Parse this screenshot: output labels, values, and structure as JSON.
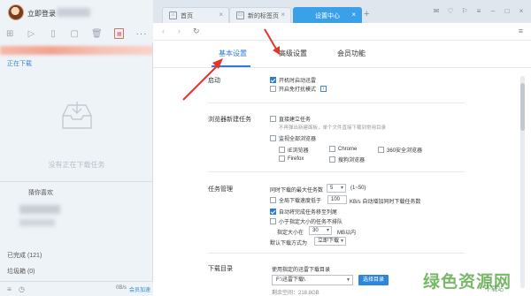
{
  "left": {
    "login_label": "立即登录",
    "downloading_label": "正在下载",
    "empty_text": "没有正在下载任务",
    "recommend_label": "猜你喜欢",
    "completed_label": "已完成 (121)",
    "trash_label": "垃圾箱 (0)",
    "speed_text": "0B/s",
    "member_label": "会员加速"
  },
  "tabs": [
    {
      "label": "首页",
      "icon": "home-icon"
    },
    {
      "label": "新的标签页",
      "icon": "page-icon"
    },
    {
      "label": "设置中心",
      "active": true
    }
  ],
  "settings_tabs": [
    {
      "label": "基本设置",
      "active": true
    },
    {
      "label": "高级设置"
    },
    {
      "label": "会员功能"
    }
  ],
  "startup": {
    "section_label": "启动",
    "auto_start": "开机时启动迅雷",
    "no_disturb": "开启免打扰模式"
  },
  "browser_task": {
    "section_label": "浏览器新建任务",
    "direct_create": "直接建立任务",
    "direct_hint": "不再弹出新建面板，单个文件直接下载到常用目录",
    "monitor_all": "监视全部浏览器",
    "browsers": [
      "IE浏览器",
      "Chrome",
      "360安全浏览器",
      "Firefox",
      "搜狗浏览器"
    ]
  },
  "task_manage": {
    "section_label": "任务管理",
    "max_tasks_label": "同时下载的最大任务数",
    "max_tasks_value": "5",
    "max_tasks_range": "(1~50)",
    "low_speed_label": "全局下载速度低于",
    "low_speed_value": "100",
    "low_speed_suffix": "KB/s 自动增加同时下载任务数",
    "auto_move_done": "自动将完成任务移至列尾",
    "small_task_label": "小于指定大小的任务不排队",
    "size_label": "指定大小在",
    "size_value": "30",
    "size_unit": "MB以内",
    "default_mode_label": "默认下载方式为",
    "default_mode_value": "立即下载"
  },
  "download_dir": {
    "section_label": "下载目录",
    "use_last_label": "使用指定的迅雷下载目录",
    "path_value": "F:\\迅雷下载\\",
    "choose_button": "选择目录",
    "free_space": "剩余空间：218.8GB"
  },
  "watermark": {
    "main": "绿色资源网",
    "sub": "下载站"
  },
  "colors": {
    "accent": "#3aa0e8",
    "link": "#2e7dd3",
    "arrow": "#e5352b"
  }
}
